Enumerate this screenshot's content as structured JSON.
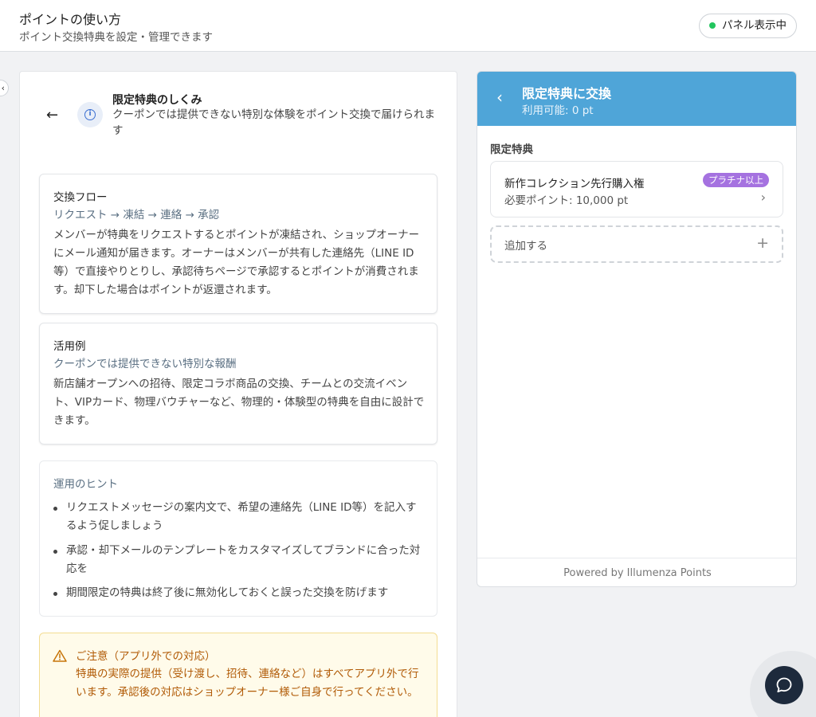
{
  "header": {
    "title": "ポイントの使い方",
    "subtitle": "ポイント交換特典を設定・管理できます",
    "panel_badge": "パネル表示中",
    "status_color": "#22c55e"
  },
  "left": {
    "section": {
      "title": "限定特典のしくみ",
      "description": "クーポンでは提供できない特別な体験をポイント交換で届けられます"
    },
    "cards": [
      {
        "title": "交換フロー",
        "subtitle": "リクエスト → 凍結 → 連絡 → 承認",
        "body": "メンバーが特典をリクエストするとポイントが凍結され、ショップオーナーにメール通知が届きます。オーナーはメンバーが共有した連絡先（LINE ID等）で直接やりとりし、承認待ちページで承認するとポイントが消費されます。却下した場合はポイントが返還されます。"
      },
      {
        "title": "活用例",
        "subtitle": "クーポンでは提供できない特別な報酬",
        "body": "新店舗オープンへの招待、限定コラボ商品の交換、チームとの交流イベント、VIPカード、物理バウチャーなど、物理的・体験型の特典を自由に設計できます。"
      }
    ],
    "hints": {
      "title": "運用のヒント",
      "items": [
        "リクエストメッセージの案内文で、希望の連絡先（LINE ID等）を記入するよう促しましょう",
        "承認・却下メールのテンプレートをカスタマイズしてブランドに合った対応を",
        "期間限定の特典は終了後に無効化しておくと誤った交換を防げます"
      ]
    },
    "warning": {
      "title": "ご注意（アプリ外での対応）",
      "body": "特典の実際の提供（受け渡し、招待、連絡など）はすべてアプリ外で行います。承認後の対応はショップオーナー様ご自身で行ってください。",
      "color": "#b15b07"
    }
  },
  "right": {
    "header": {
      "title": "限定特典に交換",
      "available": "利用可能: 0 pt",
      "color": "#4fa5d8"
    },
    "section_label": "限定特典",
    "rewards": [
      {
        "name": "新作コレクション先行購入権",
        "points": "必要ポイント: 10,000 pt",
        "tier": "プラチナ以上",
        "tier_color": "#a572e0"
      }
    ],
    "add_label": "追加する",
    "footer": "Powered by Illumenza Points"
  }
}
